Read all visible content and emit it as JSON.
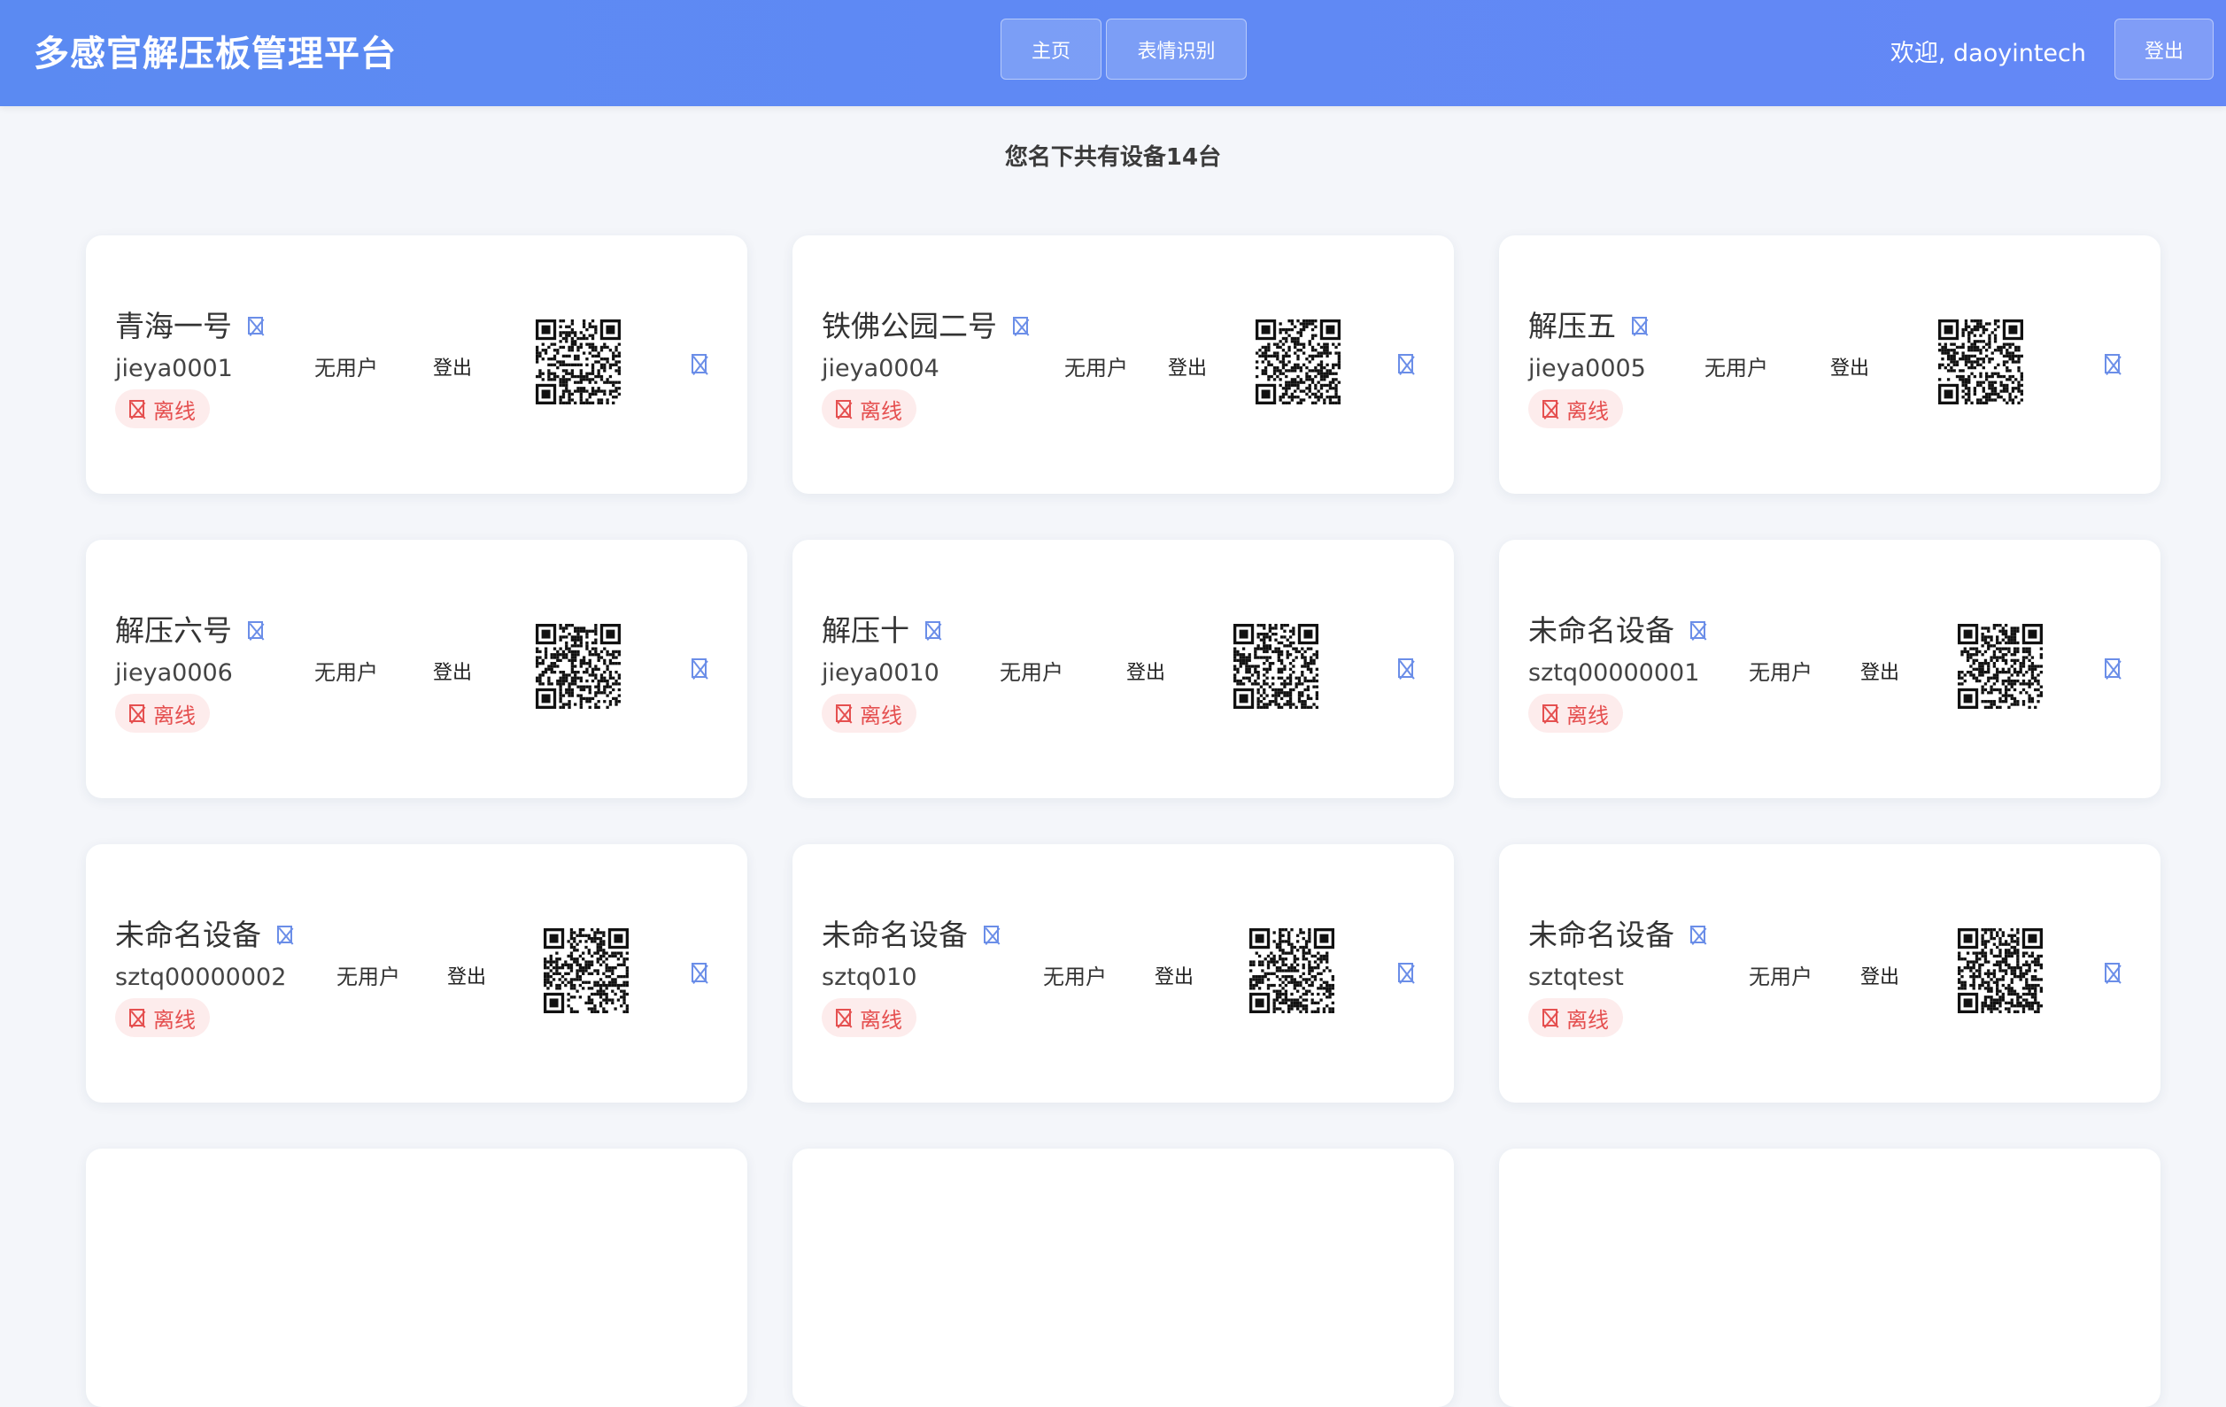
{
  "header": {
    "brand": "多感官解压板管理平台",
    "nav": [
      {
        "label": "主页"
      },
      {
        "label": "表情识别"
      }
    ],
    "welcome": "欢迎, daoyintech",
    "logout_label": "登出"
  },
  "summary": {
    "device_count_text": "您名下共有设备14台"
  },
  "devices": [
    {
      "name": "青海一号",
      "id": "jieya0001",
      "status": "离线",
      "user": "无用户",
      "logout": "登出"
    },
    {
      "name": "铁佛公园二号",
      "id": "jieya0004",
      "status": "离线",
      "user": "无用户",
      "logout": "登出"
    },
    {
      "name": "解压五",
      "id": "jieya0005",
      "status": "离线",
      "user": "无用户",
      "logout": "登出"
    },
    {
      "name": "解压六号",
      "id": "jieya0006",
      "status": "离线",
      "user": "无用户",
      "logout": "登出"
    },
    {
      "name": "解压十",
      "id": "jieya0010",
      "status": "离线",
      "user": "无用户",
      "logout": "登出"
    },
    {
      "name": "未命名设备",
      "id": "sztq00000001",
      "status": "离线",
      "user": "无用户",
      "logout": "登出"
    },
    {
      "name": "未命名设备",
      "id": "sztq00000002",
      "status": "离线",
      "user": "无用户",
      "logout": "登出"
    },
    {
      "name": "未命名设备",
      "id": "sztq010",
      "status": "离线",
      "user": "无用户",
      "logout": "登出"
    },
    {
      "name": "未命名设备",
      "id": "sztqtest",
      "status": "离线",
      "user": "无用户",
      "logout": "登出"
    },
    {
      "name": "",
      "id": "",
      "status": "",
      "user": "",
      "logout": ""
    },
    {
      "name": "",
      "id": "",
      "status": "",
      "user": "",
      "logout": ""
    },
    {
      "name": "",
      "id": "",
      "status": "",
      "user": "",
      "logout": ""
    }
  ],
  "colors": {
    "header_gradient_start": "#5b8af2",
    "header_gradient_end": "#6488f6",
    "offline_red": "#e55050",
    "offline_bg": "#fdecec",
    "icon_blue": "#6b8ee8"
  }
}
